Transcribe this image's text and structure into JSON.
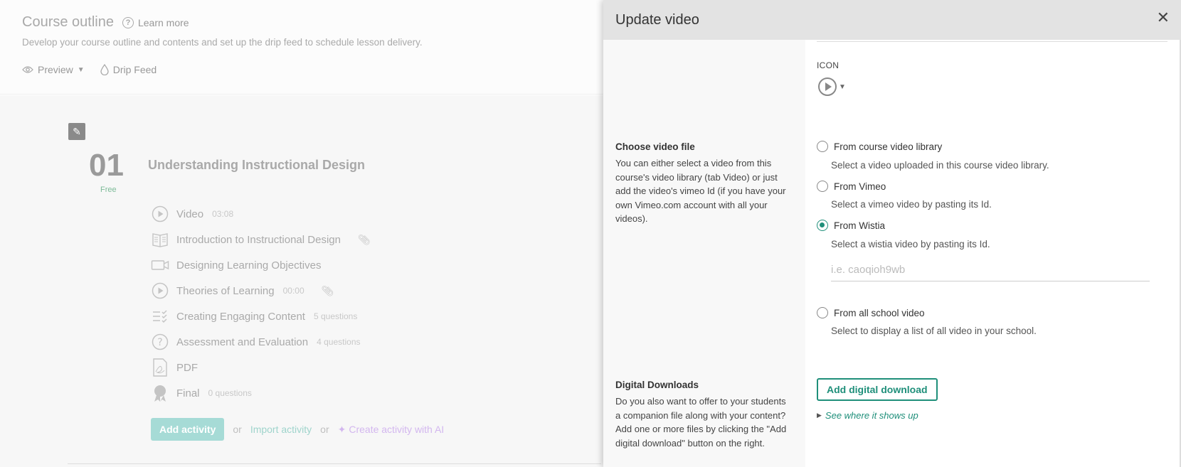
{
  "background": {
    "title": "Course outline",
    "learn_more": "Learn more",
    "subtitle": "Develop your course outline and contents and set up the drip feed to schedule lesson delivery.",
    "preview": "Preview",
    "drip_feed": "Drip Feed",
    "section": {
      "number": "01",
      "badge": "Free",
      "title": "Understanding Instructional Design"
    },
    "lessons": [
      {
        "title": "Video",
        "meta": "03:08",
        "icon": "play-circle-icon",
        "clip": false
      },
      {
        "title": "Introduction to Instructional Design",
        "meta": "",
        "icon": "book-icon",
        "clip": true
      },
      {
        "title": "Designing Learning Objectives",
        "meta": "",
        "icon": "video-camera-icon",
        "clip": false
      },
      {
        "title": "Theories of Learning",
        "meta": "00:00",
        "icon": "play-circle-icon",
        "clip": true
      },
      {
        "title": "Creating Engaging Content",
        "meta": "5 questions",
        "icon": "checklist-icon",
        "clip": false
      },
      {
        "title": "Assessment and Evaluation",
        "meta": "4 questions",
        "icon": "question-circle-icon",
        "clip": false
      },
      {
        "title": "PDF",
        "meta": "",
        "icon": "pdf-icon",
        "clip": false
      },
      {
        "title": "Final",
        "meta": "0 questions",
        "icon": "award-icon",
        "clip": false
      }
    ],
    "add_activity": "Add activity",
    "or1": "or",
    "import_activity": "Import activity",
    "or2": "or",
    "create_ai": "Create activity with AI"
  },
  "modal": {
    "title": "Update video",
    "icon_label": "ICON",
    "choose": {
      "title": "Choose video file",
      "description": "You can either select a video from this course's video library (tab Video) or just add the video's vimeo Id (if you have your own Vimeo.com account with all your videos)."
    },
    "options": [
      {
        "label": "From course video library",
        "help": "Select a video uploaded in this course video library.",
        "checked": false
      },
      {
        "label": "From Vimeo",
        "help": "Select a vimeo video by pasting its Id.",
        "checked": false
      },
      {
        "label": "From Wistia",
        "help": "Select a wistia video by pasting its Id.",
        "checked": true
      },
      {
        "label": "From all school video",
        "help": "Select to display a list of all video in your school.",
        "checked": false
      }
    ],
    "wistia_placeholder": "i.e. caoqioh9wb",
    "downloads": {
      "title": "Digital Downloads",
      "description": "Do you also want to offer to your students a companion file along with your content? Add one or more files by clicking the \"Add digital download\" button on the right.",
      "button": "Add digital download",
      "see_where": "See where it shows up"
    }
  },
  "colors": {
    "accent": "#1f8f7a"
  }
}
